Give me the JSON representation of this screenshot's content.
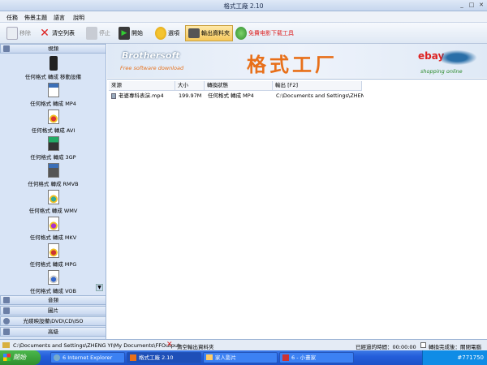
{
  "window": {
    "title": "格式工廠 2.10"
  },
  "menu": [
    "任務",
    "佈景主題",
    "語言",
    "說明"
  ],
  "toolbar": {
    "remove": "移除",
    "clear_list": "清空列表",
    "stop": "停止",
    "start": "開始",
    "options": "選項",
    "output_folder": "輸出資料夾",
    "free_download": "免費电影下载工具"
  },
  "sidebar": {
    "video_header": "視頻",
    "items": [
      "任何格式 轉成 移動設備",
      "任何格式 轉成 MP4",
      "任何格式 轉成 AVI",
      "任何格式 轉成 3GP",
      "任何格式 轉成 RMVB",
      "任何格式 轉成 WMV",
      "任何格式 轉成 MKV",
      "任何格式 轉成 MPG",
      "任何格式 轉成 VOB"
    ],
    "sections": [
      "音頻",
      "圖片",
      "光碟映設備\\DVD\\CD\\ISO",
      "高級"
    ]
  },
  "banner": {
    "brand": "Brothersoft",
    "brand_sub": "Free software download",
    "app_name": "格式工厂",
    "ebay": "ebay",
    "ebay_sub": "shopping online"
  },
  "filelist": {
    "columns": [
      "來源",
      "大小",
      "轉換狀態",
      "輸出 [F2]"
    ],
    "rows": [
      {
        "source": "老婆專科表演.mp4",
        "size": "199.97M",
        "status": "任何格式 轉成 MP4",
        "output": "C:\\Documents and Settings\\ZHENG ..."
      }
    ]
  },
  "statusbar": {
    "path": "C:\\Documents and Settings\\ZHENG YI\\My Documents\\FFOutput",
    "clear_output": "清空輸出資料夾",
    "elapsed": "已經過的時間：00:00:00",
    "after_done": "轉換完成後：關閉電腦"
  },
  "taskbar": {
    "start": "開始",
    "tasks": [
      "6 Internet Explorer",
      "格式工廠 2.10",
      "家人影片",
      "6 - 小畫家"
    ],
    "tray": "#771750"
  },
  "colors": {
    "accent": "#245edb",
    "sidebar_bg": "#d8e4f6",
    "highlight": "#f5c85c",
    "brand_orange": "#e8701a"
  }
}
